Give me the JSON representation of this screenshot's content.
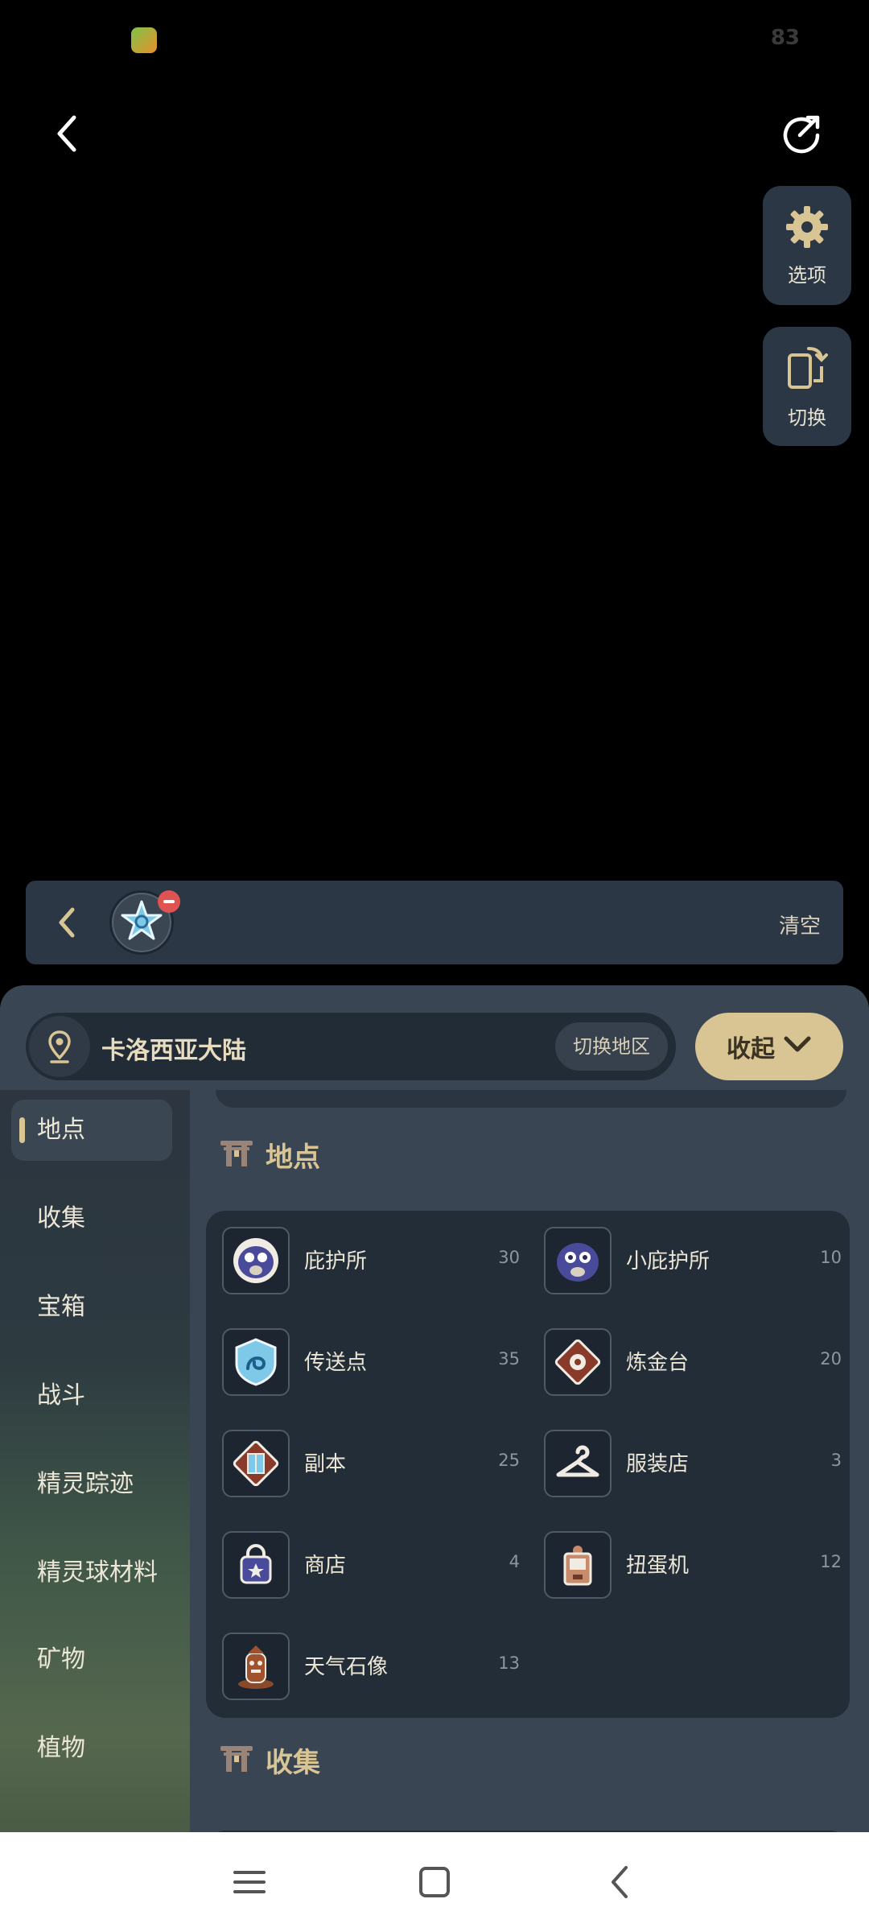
{
  "status_bar": {
    "battery": "83"
  },
  "tools": {
    "options_label": "选项",
    "switch_label": "切换"
  },
  "filter_strip": {
    "clear_label": "清空"
  },
  "region": {
    "name": "卡洛西亚大陆",
    "switch_label": "切换地区",
    "collapse_label": "收起"
  },
  "nav": {
    "items": [
      {
        "label": "地点",
        "active": true
      },
      {
        "label": "收集"
      },
      {
        "label": "宝箱"
      },
      {
        "label": "战斗"
      },
      {
        "label": "精灵踪迹"
      },
      {
        "label": "精灵球材料"
      },
      {
        "label": "矿物"
      },
      {
        "label": "植物"
      }
    ]
  },
  "sections": {
    "locations_title": "地点",
    "collect_title": "收集"
  },
  "locations": [
    {
      "name": "庇护所",
      "count": "30",
      "icon": "shelter-icon"
    },
    {
      "name": "小庇护所",
      "count": "10",
      "icon": "small-shelter-icon"
    },
    {
      "name": "传送点",
      "count": "35",
      "icon": "teleport-icon"
    },
    {
      "name": "炼金台",
      "count": "20",
      "icon": "alchemy-icon"
    },
    {
      "name": "副本",
      "count": "25",
      "icon": "dungeon-icon"
    },
    {
      "name": "服装店",
      "count": "3",
      "icon": "hanger-icon"
    },
    {
      "name": "商店",
      "count": "4",
      "icon": "shop-bag-icon"
    },
    {
      "name": "扭蛋机",
      "count": "12",
      "icon": "gacha-icon"
    },
    {
      "name": "天气石像",
      "count": "13",
      "icon": "weather-statue-icon"
    }
  ],
  "colors": {
    "accent": "#d9c594",
    "panel": "#2b3744",
    "sheet": "#3a4553",
    "card": "#232d38"
  }
}
